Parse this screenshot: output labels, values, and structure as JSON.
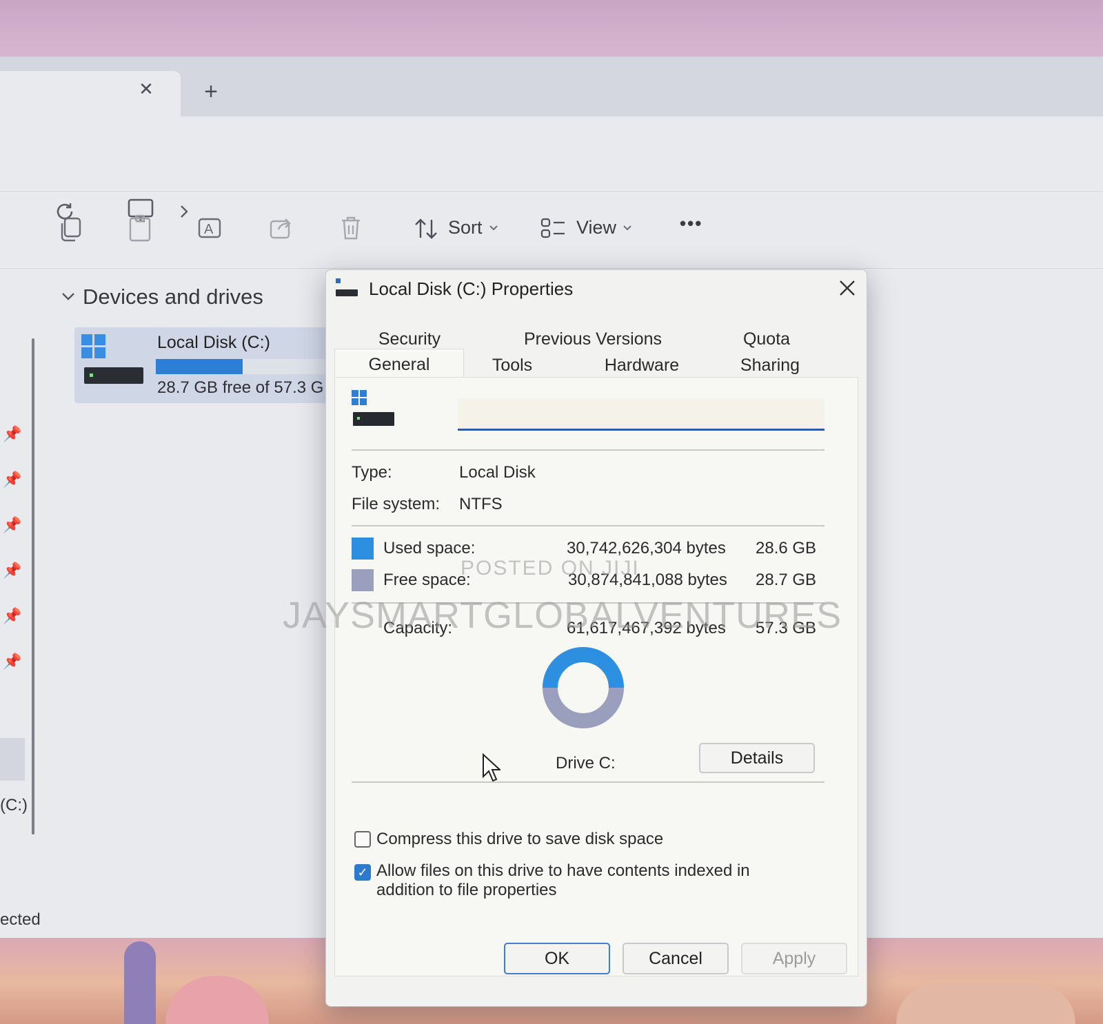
{
  "explorer": {
    "tab_close_glyph": "✕",
    "new_tab_glyph": "+",
    "toolbar": {
      "sort_label": "Sort",
      "view_label": "View",
      "more_glyph": "•••"
    },
    "group_header": "Devices and drives",
    "drive": {
      "name": "Local Disk (C:)",
      "free_text": "28.7 GB free of 57.3 G",
      "used_fraction": 0.5
    },
    "sidebar_drive_label": "(C:)",
    "status_text": "ected"
  },
  "dialog": {
    "title": "Local Disk (C:) Properties",
    "close_glyph": "✕",
    "tabs_row1": [
      "Security",
      "Previous Versions",
      "Quota"
    ],
    "tabs_row2": [
      "General",
      "Tools",
      "Hardware",
      "Sharing"
    ],
    "active_tab": "General",
    "volume_label_value": "",
    "type_label": "Type:",
    "type_value": "Local Disk",
    "fs_label": "File system:",
    "fs_value": "NTFS",
    "used_label": "Used space:",
    "used_bytes": "30,742,626,304 bytes",
    "used_gb": "28.6 GB",
    "free_label": "Free space:",
    "free_bytes": "30,874,841,088 bytes",
    "free_gb": "28.7 GB",
    "capacity_label": "Capacity:",
    "capacity_bytes": "61,617,467,392 bytes",
    "capacity_gb": "57.3 GB",
    "used_fraction": 0.499,
    "drive_caption": "Drive C:",
    "details_button": "Details",
    "compress_label": "Compress this drive to save disk space",
    "compress_checked": false,
    "index_label": "Allow files on this drive to have contents indexed in addition to file properties",
    "index_checked": true,
    "ok_button": "OK",
    "cancel_button": "Cancel",
    "apply_button": "Apply",
    "colors": {
      "used": "#2d8fe0",
      "free": "#9a9fbe"
    }
  },
  "watermark": {
    "line1": "POSTED ON JIJI",
    "line2": "JAYSMARTGLOBALVENTURES"
  }
}
